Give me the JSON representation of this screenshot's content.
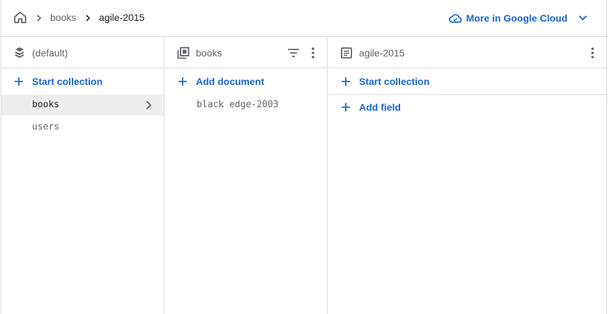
{
  "breadcrumb": {
    "items": [
      "books",
      "agile-2015"
    ]
  },
  "header": {
    "cloud_link_label": "More in Google Cloud"
  },
  "root_panel": {
    "title": "(default)",
    "start_collection_label": "Start collection",
    "collections": [
      {
        "name": "books",
        "selected": true
      },
      {
        "name": "users",
        "selected": false
      }
    ]
  },
  "collection_panel": {
    "title": "books",
    "add_document_label": "Add document",
    "documents": [
      "black edge-2003"
    ]
  },
  "document_panel": {
    "title": "agile-2015",
    "start_collection_label": "Start collection",
    "add_field_label": "Add field"
  },
  "colors": {
    "accent": "#1967d2",
    "border": "#dadce0",
    "selected_row": "#eeeeee",
    "muted_text": "#5f6368"
  },
  "icons": [
    "home-icon",
    "chevron-right-icon",
    "cloud-icon",
    "chevron-down-icon",
    "database-icon",
    "collection-icon",
    "filter-icon",
    "more-vert-icon",
    "document-icon",
    "add-icon"
  ]
}
